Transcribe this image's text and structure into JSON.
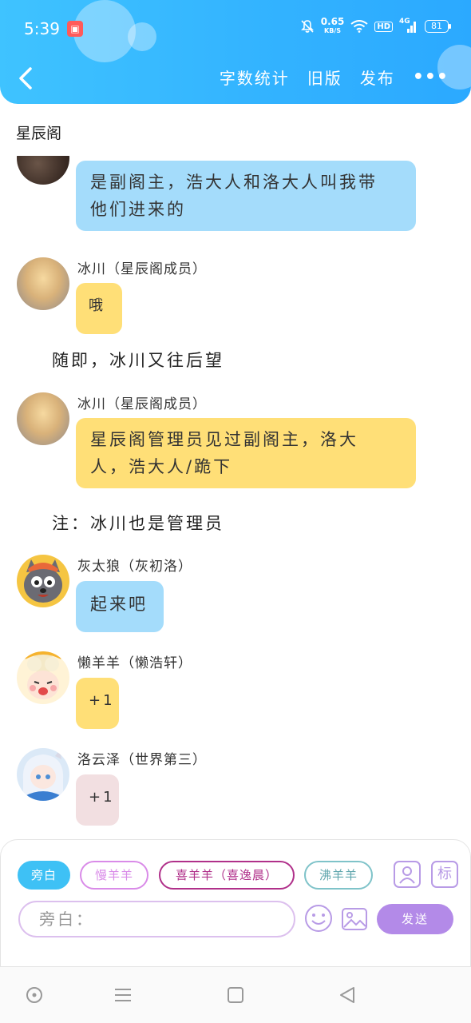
{
  "status_bar": {
    "time": "5:39",
    "net_speed_value": "0.65",
    "net_speed_unit": "KB/S",
    "hd": "HD",
    "signal_label": "4G",
    "battery": "81"
  },
  "toolbar": {
    "actions": [
      "字数统计",
      "旧版",
      "发布"
    ],
    "more": "•••"
  },
  "channel_title": "星辰阁",
  "messages": [
    {
      "type": "bubble",
      "sender": "",
      "text_lines": [
        "是副阁主，浩大人和洛大人叫我带",
        "他们进来的"
      ],
      "bubble_color": "#a4dcfb"
    },
    {
      "type": "bubble",
      "sender": "冰川（星辰阁成员）",
      "text_lines": [
        "哦"
      ],
      "bubble_color": "#ffdf77"
    },
    {
      "type": "narration",
      "text": "随即，冰川又往后望"
    },
    {
      "type": "bubble",
      "sender": "冰川（星辰阁成员）",
      "text_lines": [
        "星辰阁管理员见过副阁主，洛大",
        "人，浩大人/跪下"
      ],
      "bubble_color": "#ffdf77"
    },
    {
      "type": "narration",
      "text": "注：冰川也是管理员"
    },
    {
      "type": "bubble",
      "sender": "灰太狼（灰初洛）",
      "text_lines": [
        "起来吧"
      ],
      "bubble_color": "#a4dcfb"
    },
    {
      "type": "bubble",
      "sender": "懒羊羊（懒浩轩）",
      "text_lines": [
        "+1"
      ],
      "bubble_color": "#ffdf77"
    },
    {
      "type": "bubble",
      "sender": "洛云泽（世界第三）",
      "text_lines": [
        "+1"
      ],
      "bubble_color": "#f2dfe1"
    }
  ],
  "role_chips": [
    {
      "label": "旁白",
      "active": true,
      "color": "#3ec1f5"
    },
    {
      "label": "慢羊羊",
      "active": false,
      "color": "#d98be8"
    },
    {
      "label": "喜羊羊（喜逸晨）",
      "active": false,
      "color": "#b0308a"
    },
    {
      "label": "沸羊羊",
      "active": false,
      "color": "#5fa6ad"
    }
  ],
  "input": {
    "placeholder": "旁白："
  },
  "panel_icons": {
    "label_icon_text": "标"
  },
  "send_button": "发送",
  "colors": {
    "header": "#34b6ff",
    "accent": "#b38ae8",
    "bubble_blue": "#a4dcfb",
    "bubble_yellow": "#ffdf77"
  }
}
